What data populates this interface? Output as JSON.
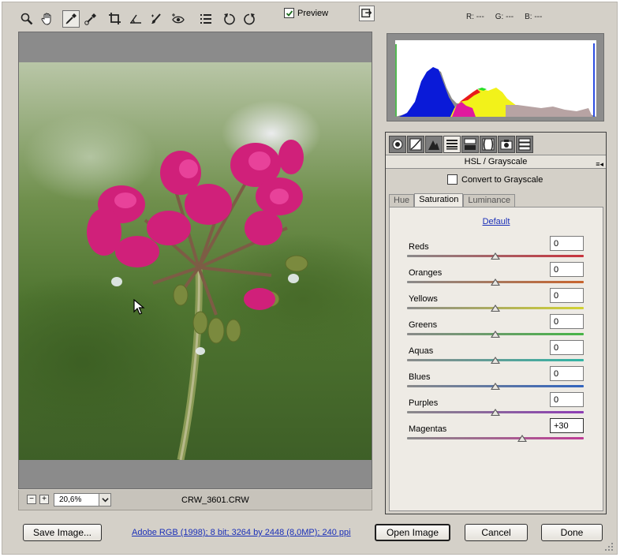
{
  "toolbar": {
    "tools": [
      {
        "name": "zoom-tool",
        "icon": "magnifier-icon"
      },
      {
        "name": "hand-tool",
        "icon": "hand-icon"
      },
      {
        "name": "white-balance-tool",
        "icon": "eyedropper-icon"
      },
      {
        "name": "color-sampler-tool",
        "icon": "color-sampler-icon"
      },
      {
        "name": "crop-tool",
        "icon": "crop-icon"
      },
      {
        "name": "straighten-tool",
        "icon": "straighten-icon"
      },
      {
        "name": "retouch-tool",
        "icon": "brush-icon"
      },
      {
        "name": "red-eye-tool",
        "icon": "eye-icon"
      },
      {
        "name": "preferences-tool",
        "icon": "list-icon"
      },
      {
        "name": "rotate-ccw-tool",
        "icon": "rotate-ccw-icon"
      },
      {
        "name": "rotate-cw-tool",
        "icon": "rotate-cw-icon"
      }
    ],
    "preview_label": "Preview",
    "preview_checked": true
  },
  "rgb_readout": {
    "r": "R: ---",
    "g": "G: ---",
    "b": "B: ---"
  },
  "canvas": {
    "zoom_minus": "−",
    "zoom_plus": "+",
    "zoom_value": "20,6%",
    "filename": "CRW_3601.CRW"
  },
  "panel": {
    "tabs": [
      "basic-icon",
      "tone-curve-icon",
      "detail-icon",
      "hsl-icon",
      "split-toning-icon",
      "lens-icon",
      "camera-calibration-icon",
      "presets-icon"
    ],
    "active_tab": 3,
    "title": "HSL / Grayscale",
    "menu_glyph": "≡◂",
    "convert_grayscale_label": "Convert to Grayscale",
    "convert_grayscale_checked": false,
    "sub_tabs": [
      "Hue",
      "Saturation",
      "Luminance"
    ],
    "active_sub_tab": 1,
    "default_link": "Default",
    "sliders": [
      {
        "label": "Reds",
        "value": "0",
        "position": 0,
        "color": "#c8323c"
      },
      {
        "label": "Oranges",
        "value": "0",
        "position": 0,
        "color": "#c8642d"
      },
      {
        "label": "Yellows",
        "value": "0",
        "position": 0,
        "color": "#d2d232"
      },
      {
        "label": "Greens",
        "value": "0",
        "position": 0,
        "color": "#46b446"
      },
      {
        "label": "Aquas",
        "value": "0",
        "position": 0,
        "color": "#32b4a5"
      },
      {
        "label": "Blues",
        "value": "0",
        "position": 0,
        "color": "#3264be"
      },
      {
        "label": "Purples",
        "value": "0",
        "position": 0,
        "color": "#8c3cb4"
      },
      {
        "label": "Magentas",
        "value": "+30",
        "position": 30,
        "color": "#be3c96"
      }
    ]
  },
  "footer": {
    "save_label": "Save Image...",
    "info_link": "Adobe RGB (1998); 8 bit; 3264 by 2448 (8,0MP); 240 ppi",
    "open_label": "Open Image",
    "cancel_label": "Cancel",
    "done_label": "Done"
  }
}
